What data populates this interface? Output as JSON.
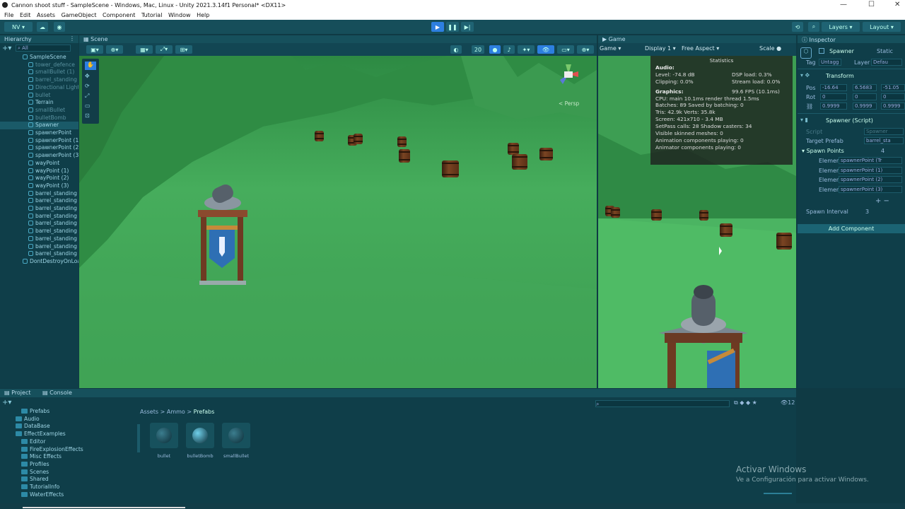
{
  "window": {
    "title": "Cannon shoot stuff - SampleScene - Windows, Mac, Linux - Unity 2021.3.14f1 Personal* <DX11>"
  },
  "menu": [
    "File",
    "Edit",
    "Assets",
    "GameObject",
    "Component",
    "Tutorial",
    "Window",
    "Help"
  ],
  "toolbar": {
    "account": "NV",
    "layers": "Layers",
    "layout": "Layout"
  },
  "hierarchy": {
    "tab": "Hierarchy",
    "search_placeholder": "All",
    "items": [
      {
        "label": "SampleScene",
        "dim": false,
        "indent": 0
      },
      {
        "label": "tower_defence",
        "dim": true,
        "indent": 1
      },
      {
        "label": "smallBullet (1)",
        "dim": true,
        "indent": 1
      },
      {
        "label": "barrel_standing",
        "dim": true,
        "indent": 1
      },
      {
        "label": "Directional Light",
        "dim": true,
        "indent": 1
      },
      {
        "label": "bullet",
        "dim": true,
        "indent": 1
      },
      {
        "label": "Terrain",
        "dim": false,
        "indent": 1
      },
      {
        "label": "smallBullet",
        "dim": true,
        "indent": 1
      },
      {
        "label": "bulletBomb",
        "dim": true,
        "indent": 1
      },
      {
        "label": "Spawner",
        "dim": false,
        "indent": 1
      },
      {
        "label": "spawnerPoint",
        "dim": false,
        "indent": 1
      },
      {
        "label": "spawnerPoint (1)",
        "dim": false,
        "indent": 1
      },
      {
        "label": "spawnerPoint (2)",
        "dim": false,
        "indent": 1
      },
      {
        "label": "spawnerPoint (3)",
        "dim": false,
        "indent": 1
      },
      {
        "label": "wayPoint",
        "dim": false,
        "indent": 1
      },
      {
        "label": "wayPoint (1)",
        "dim": false,
        "indent": 1
      },
      {
        "label": "wayPoint (2)",
        "dim": false,
        "indent": 1
      },
      {
        "label": "wayPoint (3)",
        "dim": false,
        "indent": 1
      },
      {
        "label": "barrel_standing",
        "dim": false,
        "indent": 1
      },
      {
        "label": "barrel_standing",
        "dim": false,
        "indent": 1
      },
      {
        "label": "barrel_standing",
        "dim": false,
        "indent": 1
      },
      {
        "label": "barrel_standing",
        "dim": false,
        "indent": 1
      },
      {
        "label": "barrel_standing",
        "dim": false,
        "indent": 1
      },
      {
        "label": "barrel_standing",
        "dim": false,
        "indent": 1
      },
      {
        "label": "barrel_standing",
        "dim": false,
        "indent": 1
      },
      {
        "label": "barrel_standing",
        "dim": false,
        "indent": 1
      },
      {
        "label": "barrel_standing",
        "dim": false,
        "indent": 1
      },
      {
        "label": "DontDestroyOnLoad",
        "dim": false,
        "indent": 0
      }
    ]
  },
  "scene": {
    "tab": "Scene",
    "persp": "< Persp",
    "grid_count": "20"
  },
  "game": {
    "tab": "Game",
    "mode": "Game",
    "display": "Display 1",
    "aspect": "Free Aspect",
    "scale": "Scale"
  },
  "stats": {
    "title": "Statistics",
    "audio": "Audio:",
    "level": "Level: -74.8 dB",
    "dsp": "DSP load: 0.3%",
    "clipping": "Clipping: 0.0%",
    "stream": "Stream load: 0.0%",
    "graphics": "Graphics:",
    "fps": "99.6 FPS (10.1ms)",
    "cpu": "CPU: main 10.1ms  render thread 1.5ms",
    "batches": "Batches: 89    Saved by batching: 0",
    "tris": "Tris: 42.9k       Verts: 35.8k",
    "screen": "Screen: 421x710 - 3.4 MB",
    "setpass": "SetPass calls: 28       Shadow casters: 34",
    "skinned": "Visible skinned meshes: 0",
    "anim": "Animation components playing: 0",
    "animator": "Animator components playing: 0"
  },
  "inspector": {
    "tab": "Inspector",
    "object": "Spawner",
    "static": "Static",
    "tag_label": "Tag",
    "tag": "Untagg",
    "layer_label": "Layer",
    "layer": "Defau",
    "transform": "Transform",
    "pos": {
      "label": "Pos",
      "x": "-16.64",
      "y": "6.5683",
      "z": "-51.05"
    },
    "rot": {
      "label": "Rot",
      "x": "0",
      "y": "0",
      "z": "0"
    },
    "scale": {
      "x": "0.9999",
      "y": "0.9999",
      "z": "0.9999"
    },
    "script_title": "Spawner (Script)",
    "script_label": "Script",
    "script_val": "Spawner",
    "prefab_label": "Target Prefab",
    "prefab_val": "barrel_sta",
    "spawn_points_label": "Spawn Points",
    "spawn_points_count": "4",
    "elements": [
      {
        "label": "Elemen",
        "val": "spawnerPoint (Tr"
      },
      {
        "label": "Elemen",
        "val": "spawnerPoint (1)"
      },
      {
        "label": "Elemen",
        "val": "spawnerPoint (2)"
      },
      {
        "label": "Elemen",
        "val": "spawnerPoint (3)"
      }
    ],
    "interval_label": "Spawn Interval",
    "interval_val": "3",
    "add_component": "Add Component"
  },
  "project": {
    "tab_project": "Project",
    "tab_console": "Console",
    "breadcrumb": [
      "Assets",
      "Ammo",
      "Prefabs"
    ],
    "tree": [
      {
        "label": "Prefabs",
        "indent": 2
      },
      {
        "label": "Audio",
        "indent": 1
      },
      {
        "label": "DataBase",
        "indent": 1
      },
      {
        "label": "EffectExamples",
        "indent": 1
      },
      {
        "label": "Editor",
        "indent": 2
      },
      {
        "label": "FireExplosionEffects",
        "indent": 2
      },
      {
        "label": "Misc Effects",
        "indent": 2
      },
      {
        "label": "Profiles",
        "indent": 2
      },
      {
        "label": "Scenes",
        "indent": 2
      },
      {
        "label": "Shared",
        "indent": 2
      },
      {
        "label": "TutorialInfo",
        "indent": 2
      },
      {
        "label": "WaterEffects",
        "indent": 2
      }
    ],
    "assets": [
      "bullet",
      "bulletBomb",
      "smallBullet"
    ],
    "asset_count": "12"
  },
  "watermark": {
    "line1": "Activar Windows",
    "line2": "Ve a Configuración para activar Windows."
  }
}
